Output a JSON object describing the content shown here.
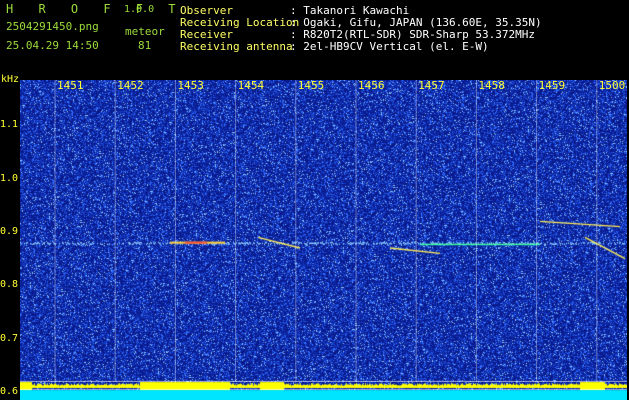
{
  "header": {
    "app_title": "H R O F F T",
    "version": "1.0.0",
    "filename": "2504291450.png",
    "timestamp": "25.04.29 14:50",
    "mode_label": "meteor",
    "count": "81"
  },
  "info": {
    "rows": [
      {
        "label": "Observer",
        "value": ": Takanori Kawachi"
      },
      {
        "label": "Receiving Location",
        "value": ": Ogaki, Gifu, JAPAN (136.60E, 35.35N)"
      },
      {
        "label": "Receiver",
        "value": ": R820T2(RTL-SDR) SDR-Sharp 53.372MHz"
      },
      {
        "label": "Receiving antenna",
        "value": ": 2el-HB9CV Vertical (el. E-W)"
      }
    ]
  },
  "chart_data": {
    "type": "heatmap",
    "ylabel": "kHz",
    "y_ticks": [
      "1.1",
      "1.0",
      "0.9",
      "0.8",
      "0.7",
      "0.6"
    ],
    "y_values": [
      1.1,
      1.0,
      0.9,
      0.8,
      0.7,
      0.6
    ],
    "x_ticks": [
      "1451",
      "1452",
      "1453",
      "1454",
      "1455",
      "1456",
      "1457",
      "1458",
      "1459",
      "1500"
    ],
    "ylim": [
      0.585,
      1.185
    ],
    "grid": true,
    "colors": {
      "background": "#0a1a8c",
      "noise": "#3a6cff",
      "signal": "#ffff00",
      "level_bar": "#ffff00",
      "level_base": "#00e5ff"
    }
  }
}
